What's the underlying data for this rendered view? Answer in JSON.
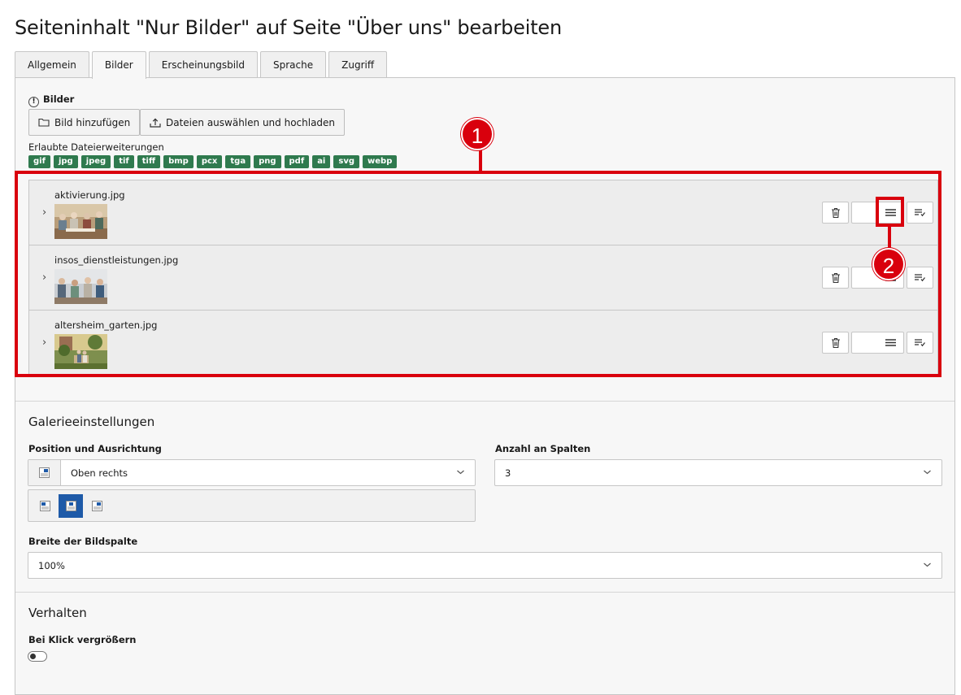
{
  "page": {
    "title": "Seiteninhalt \"Nur Bilder\" auf Seite \"Über uns\" bearbeiten"
  },
  "tabs": [
    {
      "label": "Allgemein",
      "active": false
    },
    {
      "label": "Bilder",
      "active": true
    },
    {
      "label": "Erscheinungsbild",
      "active": false
    },
    {
      "label": "Sprache",
      "active": false
    },
    {
      "label": "Zugriff",
      "active": false
    }
  ],
  "images": {
    "label": "Bilder",
    "add_button": "Bild hinzufügen",
    "upload_button": "Dateien auswählen und hochladen",
    "allowed_label": "Erlaubte Dateierweiterungen",
    "extensions": [
      "gif",
      "jpg",
      "jpeg",
      "tif",
      "tiff",
      "bmp",
      "pcx",
      "tga",
      "png",
      "pdf",
      "ai",
      "svg",
      "webp"
    ],
    "files": [
      {
        "name": "aktivierung.jpg"
      },
      {
        "name": "insos_dienstleistungen.jpg"
      },
      {
        "name": "altersheim_garten.jpg"
      }
    ]
  },
  "gallery": {
    "heading": "Galerieeinstellungen",
    "position_label": "Position und Ausrichtung",
    "position_value": "Oben rechts",
    "columns_label": "Anzahl an Spalten",
    "columns_value": "3",
    "width_label": "Breite der Bildspalte",
    "width_value": "100%"
  },
  "behavior": {
    "heading": "Verhalten",
    "zoom_label": "Bei Klick vergrößern",
    "zoom_enabled": false
  },
  "annotations": {
    "badge_1": "1",
    "badge_2": "2"
  },
  "colors": {
    "annotation": "#d9000d",
    "extension_badge": "#2f7a4e",
    "selected_position": "#1e5aa8"
  }
}
